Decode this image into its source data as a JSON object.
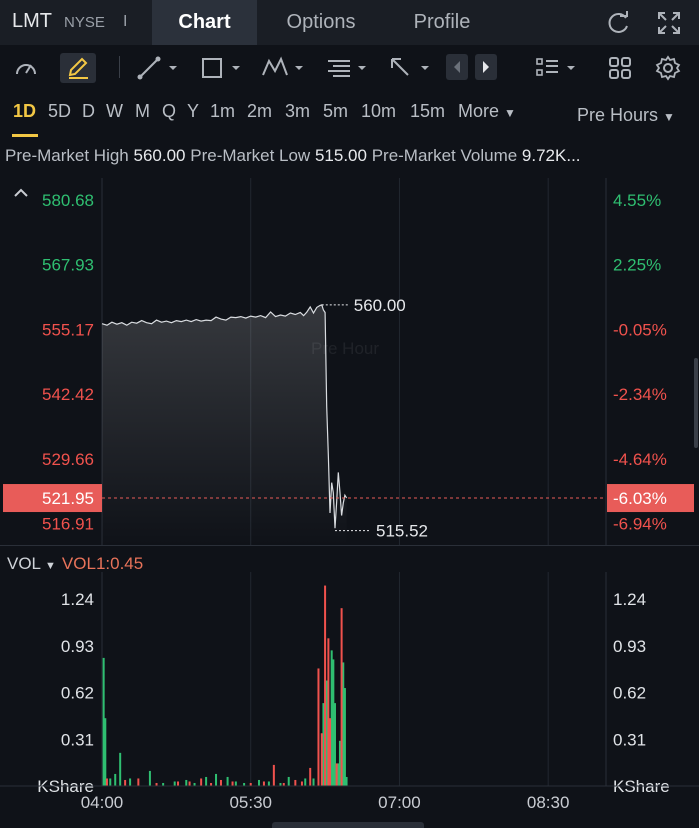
{
  "header": {
    "ticker": "LMT",
    "exchange": "NYSE",
    "separator": "I",
    "tabs": [
      {
        "label": "Chart",
        "active": true
      },
      {
        "label": "Options",
        "active": false
      },
      {
        "label": "Profile",
        "active": false
      }
    ],
    "icons": [
      "refresh-icon",
      "fullscreen-icon"
    ]
  },
  "toolbar": {
    "tools": [
      "indicator-gauge-icon",
      "draw-pencil-icon",
      "line-tool-icon",
      "rectangle-tool-icon",
      "pattern-tool-icon",
      "fibonacci-tool-icon",
      "arrow-tool-icon",
      "prev-arrow-icon",
      "next-arrow-icon",
      "list-icon",
      "grid-icon",
      "settings-icon"
    ]
  },
  "periods": {
    "items": [
      "1D",
      "5D",
      "D",
      "W",
      "M",
      "Q",
      "Y",
      "1m",
      "2m",
      "3m",
      "5m",
      "10m",
      "15m"
    ],
    "active": "1D",
    "more_label": "More",
    "session_label": "Pre Hours"
  },
  "info": {
    "high_label": "Pre-Market High",
    "high_value": "560.00",
    "low_label": "Pre-Market Low",
    "low_value": "515.00",
    "volume_label": "Pre-Market Volume",
    "volume_value": "9.72K..."
  },
  "colors": {
    "background": "#0f1218",
    "up": "#2fbf71",
    "down": "#f0524d",
    "line": "#d9dce0",
    "current_price_bg": "#e85c59",
    "grid": "#222730"
  },
  "chart_data": [
    {
      "type": "line",
      "watermark": "Pre Hour",
      "y_left_ticks": [
        "580.68",
        "567.93",
        "555.17",
        "542.42",
        "529.66",
        "516.91"
      ],
      "y_left_tick_values": [
        580.68,
        567.93,
        555.17,
        542.42,
        529.66,
        516.91
      ],
      "y_right_ticks": [
        "4.55%",
        "2.25%",
        "-0.05%",
        "-2.34%",
        "-4.64%",
        "-6.94%"
      ],
      "ylim": [
        512.5,
        585
      ],
      "x_ticks": [
        "04:00",
        "05:30",
        "07:00",
        "08:30"
      ],
      "x_tick_minutes": [
        0,
        90,
        180,
        270
      ],
      "xlim_minutes": [
        0,
        305
      ],
      "current_price": "521.95",
      "current_price_value": 521.95,
      "current_change": "-6.03%",
      "high_marker": "560.00",
      "high_marker_value": 560.0,
      "low_marker": "515.52",
      "low_marker_value": 515.52,
      "series": [
        {
          "x": [
            0,
            3,
            6,
            9,
            12,
            15,
            18,
            21,
            24,
            27,
            30,
            33,
            36,
            39,
            42,
            45,
            48,
            51,
            54,
            57,
            60,
            63,
            66,
            69,
            72,
            75,
            78,
            81,
            84,
            87,
            90,
            93,
            96,
            99,
            102,
            105,
            108,
            111,
            114,
            117,
            120,
            122,
            124,
            126,
            128,
            130,
            132,
            133,
            134,
            135,
            136,
            137,
            138,
            139,
            140,
            141,
            142,
            143,
            144,
            145,
            146,
            147,
            148
          ],
          "y": [
            556.3,
            556.0,
            556.6,
            556.2,
            556.5,
            556.0,
            556.6,
            556.4,
            556.9,
            556.5,
            556.3,
            557.0,
            556.6,
            556.8,
            556.5,
            556.9,
            556.7,
            557.0,
            556.7,
            557.1,
            556.8,
            557.0,
            556.9,
            557.6,
            557.2,
            557.0,
            557.6,
            557.5,
            557.7,
            557.4,
            557.8,
            557.6,
            557.9,
            557.5,
            558.6,
            557.7,
            558.0,
            557.8,
            558.4,
            558.1,
            558.5,
            557.9,
            558.6,
            559.6,
            558.4,
            559.5,
            559.9,
            560.0,
            559.0,
            558.5,
            540.0,
            530.0,
            519.0,
            525.0,
            523.0,
            516.0,
            521.0,
            527.0,
            523.0,
            518.5,
            521.0,
            522.5,
            521.95
          ]
        }
      ]
    },
    {
      "type": "bar",
      "title": "VOL",
      "indicator_label": "VOL1:0.45",
      "y_ticks": [
        "1.24",
        "0.93",
        "0.62",
        "0.31"
      ],
      "y_tick_values": [
        1.24,
        0.93,
        0.62,
        0.31
      ],
      "unit_label": "KShare",
      "ylim": [
        0,
        1.42
      ],
      "x_ticks": [
        "04:00",
        "05:30",
        "07:00",
        "08:30"
      ],
      "x_tick_minutes": [
        0,
        90,
        180,
        270
      ],
      "xlim_minutes": [
        0,
        305
      ],
      "series": [
        {
          "name": "up",
          "x": [
            1,
            2,
            5,
            8,
            11,
            17,
            29,
            37,
            44,
            51,
            56,
            63,
            69,
            76,
            81,
            86,
            95,
            101,
            108,
            113,
            123,
            128,
            134,
            136,
            139,
            140,
            141,
            143,
            144,
            146,
            147,
            148
          ],
          "y": [
            0.85,
            0.45,
            0.05,
            0.08,
            0.22,
            0.05,
            0.1,
            0.02,
            0.03,
            0.04,
            0.02,
            0.06,
            0.08,
            0.06,
            0.03,
            0.02,
            0.04,
            0.03,
            0.02,
            0.06,
            0.05,
            0.05,
            0.55,
            0.7,
            0.9,
            0.84,
            0.55,
            0.15,
            0.3,
            0.82,
            0.65,
            0.06
          ]
        },
        {
          "name": "down",
          "x": [
            3,
            14,
            22,
            33,
            46,
            53,
            60,
            66,
            72,
            79,
            90,
            98,
            104,
            110,
            117,
            121,
            126,
            131,
            133,
            135,
            137,
            138,
            142,
            145
          ],
          "y": [
            0.05,
            0.04,
            0.05,
            0.02,
            0.03,
            0.03,
            0.05,
            0.02,
            0.04,
            0.03,
            0.02,
            0.03,
            0.14,
            0.02,
            0.04,
            0.03,
            0.12,
            0.78,
            0.35,
            1.33,
            0.98,
            0.45,
            0.15,
            1.18
          ]
        }
      ]
    }
  ]
}
